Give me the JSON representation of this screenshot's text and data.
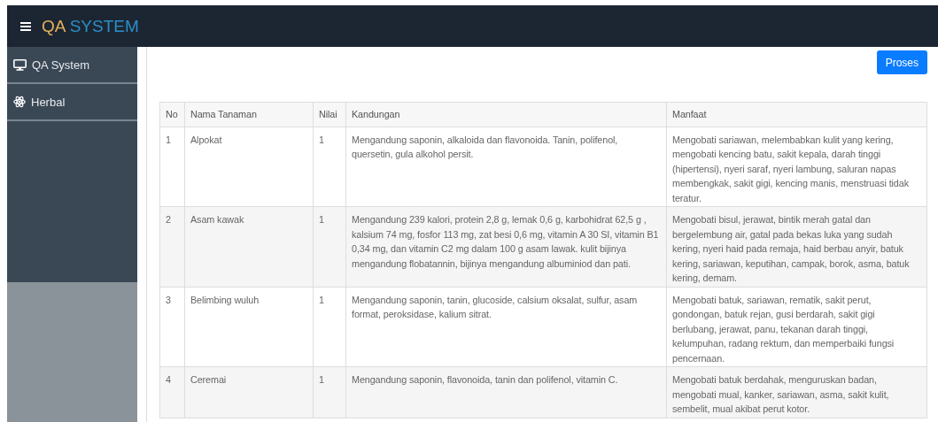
{
  "header": {
    "brand_first": "QA",
    "brand_second": "SYSTEM"
  },
  "sidebar": {
    "items": [
      {
        "label": "QA System",
        "kind": "monitor"
      },
      {
        "label": "Herbal",
        "kind": "atom"
      }
    ]
  },
  "toolbar": {
    "button": "Proses"
  },
  "table": {
    "columns": [
      "No",
      "Nama Tanaman",
      "Nilai",
      "Kandungan",
      "Manfaat"
    ],
    "rows": [
      [
        "1",
        "Alpokat",
        "1",
        "Mengandung saponin, alkaloida dan flavonoida. Tanin, polifenol, quersetin, gula alkohol persit.",
        "Mengobati sariawan, melembabkan kulit yang kering, mengobati kencing batu, sakit kepala, darah tinggi (hipertensi), nyeri saraf, nyeri lambung, saluran napas membengkak, sakit gigi, kencing manis, menstruasi tidak teratur."
      ],
      [
        "2",
        "Asam kawak",
        "1",
        "Mengandung 239 kalori, protein 2,8 g, lemak 0,6 g, karbohidrat 62,5 g , kalsium 74 mg, fosfor 113 mg, zat besi 0,6 mg, vitamin A 30 SI, vitamin B1 0,34 mg, dan vitamin C2 mg dalam 100 g asam lawak. kulit bijinya mengandung flobatannin, bijinya mengandung albuminiod dan pati.",
        "Mengobati bisul, jerawat, bintik merah gatal dan bergelembung air, gatal pada bekas luka yang sudah kering, nyeri haid pada remaja, haid berbau anyir, batuk kering, sariawan, keputihan, campak, borok, asma, batuk kering, demam."
      ],
      [
        "3",
        "Belimbing wuluh",
        "1",
        "Mengandung saponin, tanin, glucoside, calsium oksalat, sulfur, asam format, peroksidase, kalium sitrat.",
        "Mengobati batuk, sariawan, rematik, sakit perut, gondongan, batuk rejan, gusi berdarah, sakit gigi berlubang, jerawat, panu, tekanan darah tinggi, kelumpuhan, radang rektum, dan memperbaiki fungsi pencernaan."
      ],
      [
        "4",
        "Ceremai",
        "1",
        "Mengandung saponin, flavonoida, tanin dan polifenol, vitamin C.",
        "Mengobati batuk berdahak, menguruskan badan, mengobati mual, kanker, sariawan, asma, sakit kulit, sembelit, mual akibat perut kotor."
      ]
    ]
  }
}
